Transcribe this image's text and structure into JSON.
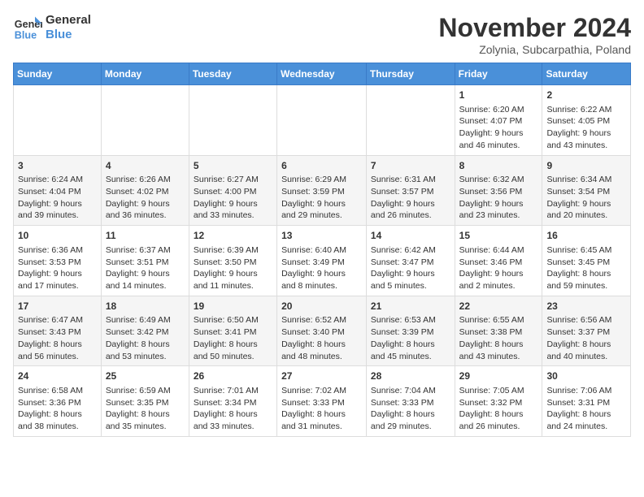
{
  "logo": {
    "line1": "General",
    "line2": "Blue"
  },
  "title": "November 2024",
  "location": "Zolynia, Subcarpathia, Poland",
  "days_of_week": [
    "Sunday",
    "Monday",
    "Tuesday",
    "Wednesday",
    "Thursday",
    "Friday",
    "Saturday"
  ],
  "weeks": [
    [
      {
        "day": "",
        "info": ""
      },
      {
        "day": "",
        "info": ""
      },
      {
        "day": "",
        "info": ""
      },
      {
        "day": "",
        "info": ""
      },
      {
        "day": "",
        "info": ""
      },
      {
        "day": "1",
        "info": "Sunrise: 6:20 AM\nSunset: 4:07 PM\nDaylight: 9 hours and 46 minutes."
      },
      {
        "day": "2",
        "info": "Sunrise: 6:22 AM\nSunset: 4:05 PM\nDaylight: 9 hours and 43 minutes."
      }
    ],
    [
      {
        "day": "3",
        "info": "Sunrise: 6:24 AM\nSunset: 4:04 PM\nDaylight: 9 hours and 39 minutes."
      },
      {
        "day": "4",
        "info": "Sunrise: 6:26 AM\nSunset: 4:02 PM\nDaylight: 9 hours and 36 minutes."
      },
      {
        "day": "5",
        "info": "Sunrise: 6:27 AM\nSunset: 4:00 PM\nDaylight: 9 hours and 33 minutes."
      },
      {
        "day": "6",
        "info": "Sunrise: 6:29 AM\nSunset: 3:59 PM\nDaylight: 9 hours and 29 minutes."
      },
      {
        "day": "7",
        "info": "Sunrise: 6:31 AM\nSunset: 3:57 PM\nDaylight: 9 hours and 26 minutes."
      },
      {
        "day": "8",
        "info": "Sunrise: 6:32 AM\nSunset: 3:56 PM\nDaylight: 9 hours and 23 minutes."
      },
      {
        "day": "9",
        "info": "Sunrise: 6:34 AM\nSunset: 3:54 PM\nDaylight: 9 hours and 20 minutes."
      }
    ],
    [
      {
        "day": "10",
        "info": "Sunrise: 6:36 AM\nSunset: 3:53 PM\nDaylight: 9 hours and 17 minutes."
      },
      {
        "day": "11",
        "info": "Sunrise: 6:37 AM\nSunset: 3:51 PM\nDaylight: 9 hours and 14 minutes."
      },
      {
        "day": "12",
        "info": "Sunrise: 6:39 AM\nSunset: 3:50 PM\nDaylight: 9 hours and 11 minutes."
      },
      {
        "day": "13",
        "info": "Sunrise: 6:40 AM\nSunset: 3:49 PM\nDaylight: 9 hours and 8 minutes."
      },
      {
        "day": "14",
        "info": "Sunrise: 6:42 AM\nSunset: 3:47 PM\nDaylight: 9 hours and 5 minutes."
      },
      {
        "day": "15",
        "info": "Sunrise: 6:44 AM\nSunset: 3:46 PM\nDaylight: 9 hours and 2 minutes."
      },
      {
        "day": "16",
        "info": "Sunrise: 6:45 AM\nSunset: 3:45 PM\nDaylight: 8 hours and 59 minutes."
      }
    ],
    [
      {
        "day": "17",
        "info": "Sunrise: 6:47 AM\nSunset: 3:43 PM\nDaylight: 8 hours and 56 minutes."
      },
      {
        "day": "18",
        "info": "Sunrise: 6:49 AM\nSunset: 3:42 PM\nDaylight: 8 hours and 53 minutes."
      },
      {
        "day": "19",
        "info": "Sunrise: 6:50 AM\nSunset: 3:41 PM\nDaylight: 8 hours and 50 minutes."
      },
      {
        "day": "20",
        "info": "Sunrise: 6:52 AM\nSunset: 3:40 PM\nDaylight: 8 hours and 48 minutes."
      },
      {
        "day": "21",
        "info": "Sunrise: 6:53 AM\nSunset: 3:39 PM\nDaylight: 8 hours and 45 minutes."
      },
      {
        "day": "22",
        "info": "Sunrise: 6:55 AM\nSunset: 3:38 PM\nDaylight: 8 hours and 43 minutes."
      },
      {
        "day": "23",
        "info": "Sunrise: 6:56 AM\nSunset: 3:37 PM\nDaylight: 8 hours and 40 minutes."
      }
    ],
    [
      {
        "day": "24",
        "info": "Sunrise: 6:58 AM\nSunset: 3:36 PM\nDaylight: 8 hours and 38 minutes."
      },
      {
        "day": "25",
        "info": "Sunrise: 6:59 AM\nSunset: 3:35 PM\nDaylight: 8 hours and 35 minutes."
      },
      {
        "day": "26",
        "info": "Sunrise: 7:01 AM\nSunset: 3:34 PM\nDaylight: 8 hours and 33 minutes."
      },
      {
        "day": "27",
        "info": "Sunrise: 7:02 AM\nSunset: 3:33 PM\nDaylight: 8 hours and 31 minutes."
      },
      {
        "day": "28",
        "info": "Sunrise: 7:04 AM\nSunset: 3:33 PM\nDaylight: 8 hours and 29 minutes."
      },
      {
        "day": "29",
        "info": "Sunrise: 7:05 AM\nSunset: 3:32 PM\nDaylight: 8 hours and 26 minutes."
      },
      {
        "day": "30",
        "info": "Sunrise: 7:06 AM\nSunset: 3:31 PM\nDaylight: 8 hours and 24 minutes."
      }
    ]
  ]
}
